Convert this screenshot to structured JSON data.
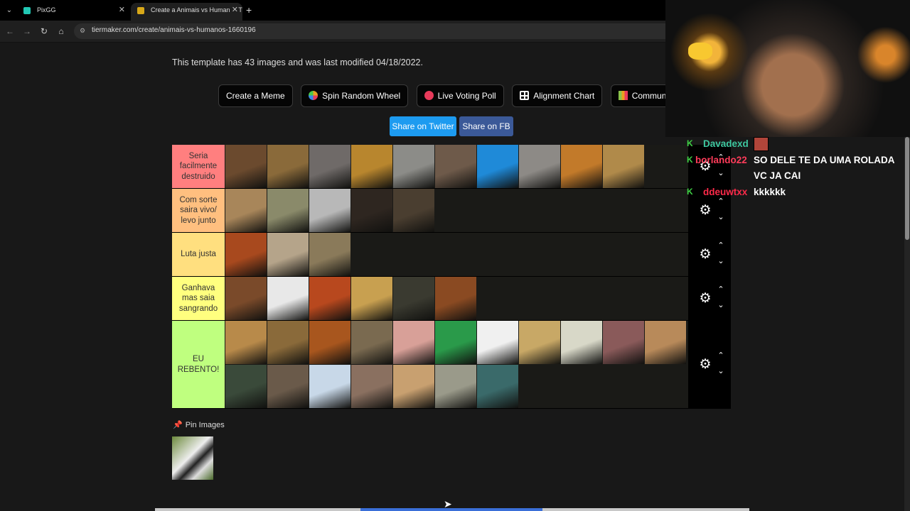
{
  "browser": {
    "tabs": [
      {
        "title": "PixGG",
        "favicon_color": "#22c8b4",
        "active": false
      },
      {
        "title": "Create a Animais vs Humanos T",
        "favicon_color": "#d8a818",
        "active": true
      }
    ],
    "url": "tiermaker.com/create/animais-vs-humanos-1660196"
  },
  "page": {
    "template_info": "This template has 43 images and was last modified 04/18/2022.",
    "buttons": [
      {
        "label": "Create a Meme",
        "icon": "",
        "icon_color": ""
      },
      {
        "label": "Spin Random Wheel",
        "icon": "wheel-icon",
        "icon_color": "#e8a020"
      },
      {
        "label": "Live Voting Poll",
        "icon": "poll-dot-icon",
        "icon_color": "#e83a5a"
      },
      {
        "label": "Alignment Chart",
        "icon": "grid-icon",
        "icon_color": "#ffffff"
      },
      {
        "label": "Community R",
        "icon": "mosaic-icon",
        "icon_color": "#8bc34a"
      }
    ],
    "share_twitter": "Share on Twitter",
    "share_fb": "Share on FB",
    "tiers": [
      {
        "label": "Seria facilmente destruido",
        "color": "#ff7f7f",
        "items": [
          "#6b4a2e",
          "#8a6a3a",
          "#6f6a68",
          "#b8862e",
          "#8c8c88",
          "#6e5a4a",
          "#1f8ad8",
          "#8d8a86",
          "#c27a2a",
          "#b08a4a"
        ]
      },
      {
        "label": "Com sorte saira vivo/ levo junto",
        "color": "#ffbf7f",
        "items": [
          "#a8865a",
          "#8a8a6a",
          "#b8b8b8",
          "#2e2620",
          "#4a3e30"
        ]
      },
      {
        "label": "Luta justa",
        "color": "#ffdf7f",
        "items": [
          "#a8491e",
          "#b5a48a",
          "#8a7a5a"
        ]
      },
      {
        "label": "Ganhava mas saia sangrando",
        "color": "#ffff7f",
        "items": [
          "#7a4a2a",
          "#e8e8e8",
          "#b8481e",
          "#c8a050",
          "#3a3a30",
          "#8a4a22"
        ]
      },
      {
        "label": "EU REBENTO!",
        "color": "#bfff7f",
        "items": [
          "#b88a4a",
          "#8a6a3a",
          "#a8561e",
          "#7a6a50",
          "#d8a098",
          "#2a9a4a",
          "#f0f0f0",
          "#c8a866",
          "#d8d8c8",
          "#8a5a5a",
          "#b88a5a",
          "#3a4a3a",
          "#6a5a4a",
          "#c8d8e8",
          "#8a7060",
          "#c8a070",
          "#9a9a8a",
          "#3a6a6a"
        ]
      }
    ],
    "pin_images_label": "Pin Images"
  },
  "overlay": {
    "chat": [
      {
        "user": "Davadexd",
        "user_color": "#3ec8a0",
        "message": ""
      },
      {
        "user": "borlando22",
        "user_color": "#ff3c5a",
        "message": "SO DELE TE DA UMA ROLADA VC JA CAI"
      },
      {
        "user": "ddeuwtxx",
        "user_color": "#ff2a4a",
        "message": "kkkkkk"
      }
    ]
  }
}
